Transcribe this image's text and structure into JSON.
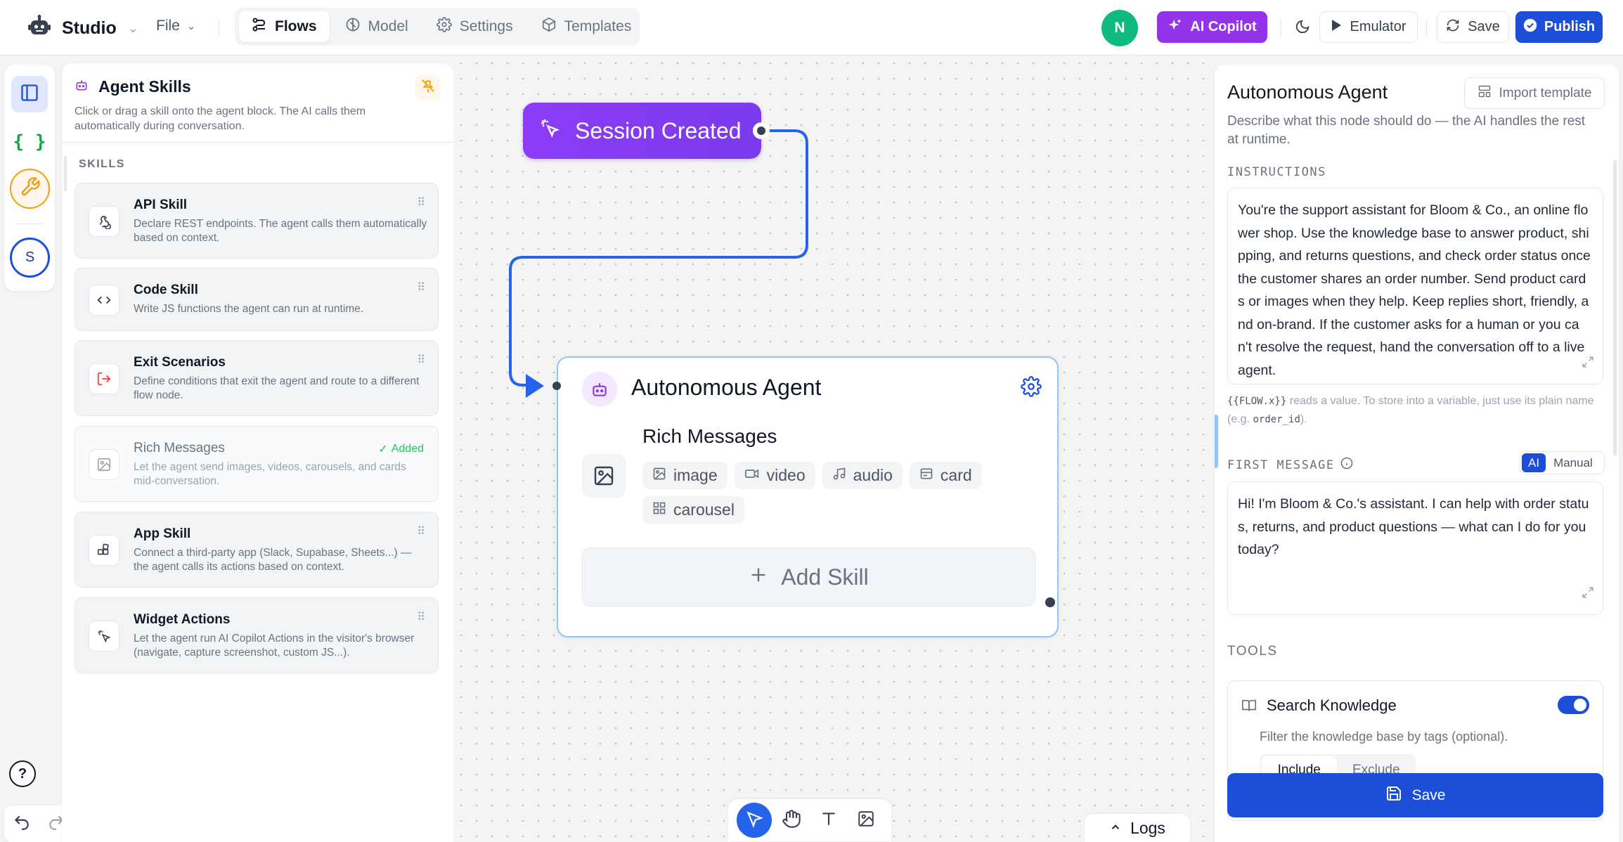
{
  "topbar": {
    "app_name": "Studio",
    "file_menu": "File",
    "tabs": [
      {
        "label": "Flows",
        "icon": "flows-icon",
        "active": true
      },
      {
        "label": "Model",
        "icon": "model-icon",
        "active": false
      },
      {
        "label": "Settings",
        "icon": "gear-icon",
        "active": false
      },
      {
        "label": "Templates",
        "icon": "cube-icon",
        "active": false
      }
    ],
    "user_initial": "N",
    "copilot_label": "AI Copilot",
    "emulator_label": "Emulator",
    "save_label": "Save",
    "publish_label": "Publish"
  },
  "rail": {
    "user_initial": "S"
  },
  "skills_panel": {
    "title": "Agent Skills",
    "description": "Click or drag a skill onto the agent block. The AI calls them automatically during conversation.",
    "section_label": "SKILLS",
    "skills": [
      {
        "name": "API Skill",
        "description": "Declare REST endpoints. The agent calls them automatically based on context.",
        "icon": "webhook-icon",
        "added": false
      },
      {
        "name": "Code Skill",
        "description": "Write JS functions the agent can run at runtime.",
        "icon": "code-icon",
        "added": false
      },
      {
        "name": "Exit Scenarios",
        "description": "Define conditions that exit the agent and route to a different flow node.",
        "icon": "exit-icon",
        "added": false
      },
      {
        "name": "Rich Messages",
        "description": "Let the agent send images, videos, carousels, and cards mid-conversation.",
        "icon": "image-icon",
        "added": true,
        "added_label": "Added"
      },
      {
        "name": "App Skill",
        "description": "Connect a third-party app (Slack, Supabase, Sheets...) — the agent calls its actions based on context.",
        "icon": "apps-icon",
        "added": false
      },
      {
        "name": "Widget Actions",
        "description": "Let the agent run AI Copilot Actions in the visitor's browser (navigate, capture screenshot, custom JS...).",
        "icon": "pointer-click-icon",
        "added": false
      }
    ]
  },
  "canvas": {
    "session_node": {
      "label": "Session Created"
    },
    "agent_node": {
      "title": "Autonomous Agent",
      "rich_messages_title": "Rich Messages",
      "chips": [
        {
          "label": "image",
          "icon": "image-icon"
        },
        {
          "label": "video",
          "icon": "video-icon"
        },
        {
          "label": "audio",
          "icon": "music-icon"
        },
        {
          "label": "card",
          "icon": "card-icon"
        },
        {
          "label": "carousel",
          "icon": "grid-icon"
        }
      ],
      "add_skill_label": "Add Skill"
    },
    "logs_label": "Logs"
  },
  "right_panel": {
    "title": "Autonomous Agent",
    "import_label": "Import template",
    "description": "Describe what this node should do — the AI handles the rest at runtime.",
    "instructions_label": "INSTRUCTIONS",
    "instructions": "You're the support assistant for Bloom & Co., an online flower shop. Use the knowledge base to answer product, shipping, and returns questions, and check order status once the customer shares an order number. Send product cards or images when they help. Keep replies short, friendly, and on-brand. If the customer asks for a human or you can't resolve the request, hand the conversation off to a live agent.",
    "hint_code": "{{FLOW.x}}",
    "hint_text_1": " reads a value. To store into a variable, just use its plain name (e.g. ",
    "hint_code_2": "order_id",
    "hint_text_2": ").",
    "first_message_label": "FIRST MESSAGE",
    "mode_ai": "AI",
    "mode_manual": "Manual",
    "first_message": "Hi! I'm Bloom & Co.'s assistant. I can help with order status, returns, and product questions — what can I do for you today?",
    "tools_label": "TOOLS",
    "tool": {
      "name": "Search Knowledge",
      "enabled": true,
      "description": "Filter the knowledge base by tags (optional).",
      "include_label": "Include",
      "exclude_label": "Exclude"
    },
    "save_label": "Save"
  },
  "colors": {
    "primary": "#1d4ed8",
    "purple": "#7c3aed",
    "green": "#10b981",
    "edge": "#2563eb"
  }
}
